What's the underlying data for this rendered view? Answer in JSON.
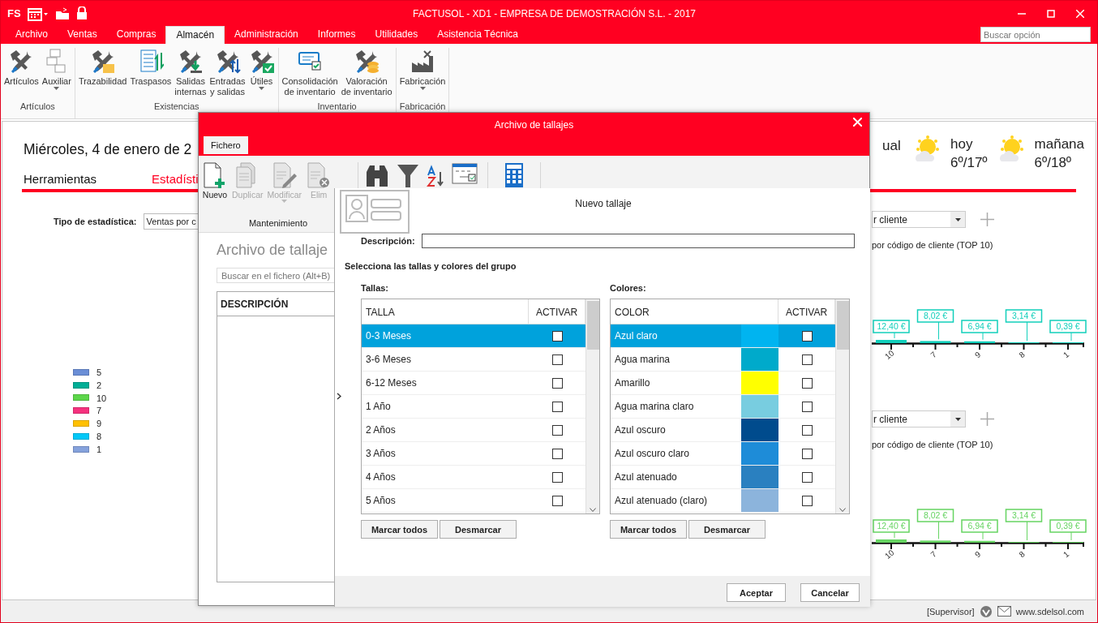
{
  "title_bar": {
    "logo": "FS",
    "title": "FACTUSOL - XD1 - EMPRESA DE DEMOSTRACIÓN S.L. - 2017"
  },
  "menu_tabs": [
    {
      "label": "Archivo",
      "selected": false
    },
    {
      "label": "Ventas",
      "selected": false
    },
    {
      "label": "Compras",
      "selected": false
    },
    {
      "label": "Almacén",
      "selected": true
    },
    {
      "label": "Administración",
      "selected": false
    },
    {
      "label": "Informes",
      "selected": false
    },
    {
      "label": "Utilidades",
      "selected": false
    },
    {
      "label": "Asistencia Técnica",
      "selected": false
    }
  ],
  "search": {
    "placeholder": "Buscar opción"
  },
  "ribbon": [
    {
      "label": "Artículos",
      "buttons": [
        {
          "label": "Artículos",
          "dropdown": false
        },
        {
          "label": "Auxiliar",
          "dropdown": true
        }
      ]
    },
    {
      "label": "Existencias",
      "buttons": [
        {
          "label": "Trazabilidad",
          "dropdown": false
        },
        {
          "label": "Traspasos",
          "dropdown": false
        },
        {
          "label": "Salidas\ninternas",
          "dropdown": false
        },
        {
          "label": "Entradas\ny salidas",
          "dropdown": false
        },
        {
          "label": "Útiles",
          "dropdown": true
        }
      ]
    },
    {
      "label": "Inventario",
      "buttons": [
        {
          "label": "Consolidación\nde inventario",
          "dropdown": false
        },
        {
          "label": "Valoración\nde inventario",
          "dropdown": false
        }
      ]
    },
    {
      "label": "Fabricación",
      "buttons": [
        {
          "label": "Fabricación",
          "dropdown": true
        }
      ]
    }
  ],
  "dashboard": {
    "date": "Miércoles, 4 de enero de 2",
    "weather_partial": "ual",
    "forecast": [
      {
        "day": "hoy",
        "temps": "6º/17º"
      },
      {
        "day": "mañana",
        "temps": "6º/18º"
      }
    ],
    "tabs": [
      {
        "label": "Herramientas",
        "selected": false
      },
      {
        "label": "Estadísti",
        "selected": true
      }
    ],
    "stat_type": {
      "label": "Tipo de estadística:",
      "value": "Ventas por c"
    },
    "legend": [
      {
        "label": "5",
        "color": "#6a8ed6"
      },
      {
        "label": "2",
        "color": "#00ae96"
      },
      {
        "label": "10",
        "color": "#5cd64a"
      },
      {
        "label": "7",
        "color": "#f5327e"
      },
      {
        "label": "9",
        "color": "#ffc000"
      },
      {
        "label": "8",
        "color": "#00c8f8"
      },
      {
        "label": "1",
        "color": "#85a2dc"
      }
    ],
    "panels": [
      {
        "select": "r cliente",
        "caption": "por código de cliente (TOP 10)",
        "chart_data": {
          "type": "bar",
          "categories": [
            "10",
            "7",
            "9",
            "8",
            "1"
          ],
          "series": [
            {
              "color": "#12cfbb",
              "values": [
                12.4,
                8.02,
                6.94,
                3.14,
                0.39
              ],
              "value_labels": [
                "12,40 €",
                "8,02 €",
                "6,94 €",
                "3,14 €",
                "0,39 €"
              ]
            }
          ],
          "data_labels": true
        }
      },
      {
        "select": "r cliente",
        "caption": "por código de cliente (TOP 10)",
        "chart_data": {
          "type": "bar",
          "categories": [
            "10",
            "7",
            "9",
            "8",
            "1"
          ],
          "series": [
            {
              "color": "#66d462",
              "values": [
                12.4,
                8.02,
                6.94,
                3.14,
                0.39
              ],
              "value_labels": [
                "12,40 €",
                "8,02 €",
                "6,94 €",
                "3,14 €",
                "0,39 €"
              ]
            }
          ],
          "data_labels": true
        }
      }
    ]
  },
  "dialog": {
    "title": "Archivo de tallajes",
    "tabs": [
      {
        "label": "Fichero",
        "selected": true
      }
    ],
    "toolbar": [
      {
        "label": "Nuevo",
        "disabled": false,
        "dropdown": false
      },
      {
        "label": "Duplicar",
        "disabled": true,
        "dropdown": false
      },
      {
        "label": "Modificar",
        "disabled": true,
        "dropdown": true
      },
      {
        "label": "Elim",
        "disabled": true,
        "dropdown": false
      }
    ],
    "toolbar_group": "Mantenimiento",
    "list_title": "Archivo de tallaje",
    "search_placeholder": "Buscar en el fichero (Alt+B)",
    "columns": [
      "DESCRIPCIÓN"
    ],
    "form": {
      "title": "Nuevo tallaje",
      "description_label": "Descripción:",
      "instruction": "Selecciona las tallas y colores del grupo",
      "sizes": {
        "label": "Tallas:",
        "columns": [
          "TALLA",
          "ACTIVAR"
        ],
        "rows": [
          {
            "name": "0-3 Meses",
            "selected": true,
            "checked": false
          },
          {
            "name": "3-6 Meses",
            "selected": false,
            "checked": false
          },
          {
            "name": "6-12 Meses",
            "selected": false,
            "checked": false
          },
          {
            "name": "1 Año",
            "selected": false,
            "checked": false
          },
          {
            "name": "2 Años",
            "selected": false,
            "checked": false
          },
          {
            "name": "3 Años",
            "selected": false,
            "checked": false
          },
          {
            "name": "4 Años",
            "selected": false,
            "checked": false
          },
          {
            "name": "5 Años",
            "selected": false,
            "checked": false
          }
        ],
        "buttons": [
          "Marcar todos",
          "Desmarcar"
        ]
      },
      "colors": {
        "label": "Colores:",
        "columns": [
          "COLOR",
          "ACTIVAR"
        ],
        "rows": [
          {
            "name": "Azul claro",
            "color": "#00b4f0",
            "selected": true,
            "checked": false
          },
          {
            "name": "Agua marina",
            "color": "#00aacb",
            "selected": false,
            "checked": false
          },
          {
            "name": "Amarillo",
            "color": "#ffff00",
            "selected": false,
            "checked": false
          },
          {
            "name": "Agua marina claro",
            "color": "#78cde0",
            "selected": false,
            "checked": false
          },
          {
            "name": "Azul oscuro",
            "color": "#004b8d",
            "selected": false,
            "checked": false
          },
          {
            "name": "Azul oscuro claro",
            "color": "#1e8cd8",
            "selected": false,
            "checked": false
          },
          {
            "name": "Azul atenuado",
            "color": "#2a80c0",
            "selected": false,
            "checked": false
          },
          {
            "name": "Azul atenuado (claro)",
            "color": "#8cb4dc",
            "selected": false,
            "checked": false
          }
        ],
        "buttons": [
          "Marcar todos",
          "Desmarcar"
        ]
      },
      "buttons": [
        "Aceptar",
        "Cancelar"
      ]
    }
  },
  "status_bar": {
    "user": "[Supervisor]",
    "website": "www.sdelsol.com"
  }
}
